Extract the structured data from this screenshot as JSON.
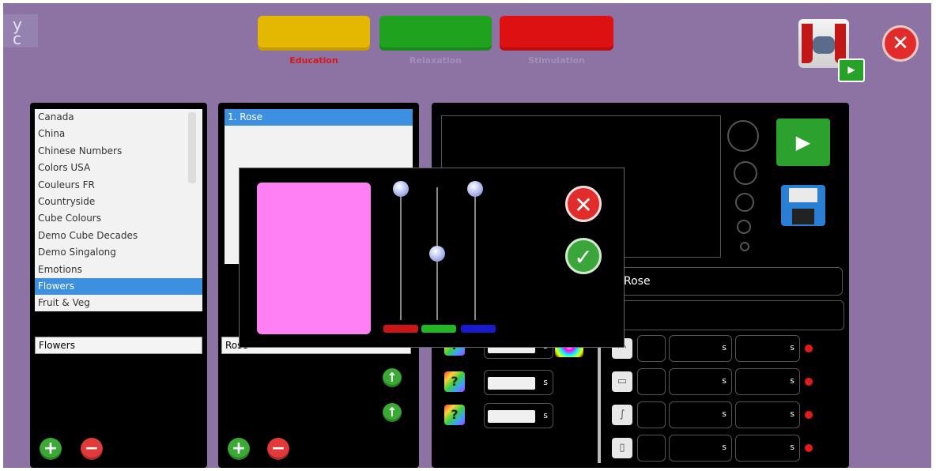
{
  "app": {
    "logo_text": "y\nc"
  },
  "tabs": [
    {
      "label": "Education",
      "color": "#e4b800",
      "label_color": "#d21a1a"
    },
    {
      "label": "Relaxation",
      "color": "#1fa31f",
      "label_color": "#a08fb8"
    },
    {
      "label": "Stimulation",
      "color": "#dd1111",
      "label_color": "#a08fb8"
    }
  ],
  "top_right": {
    "theater_icon": "theater-icon",
    "close_icon": "close-icon"
  },
  "left_panel": {
    "items": [
      "Canada",
      "China",
      "Chinese Numbers",
      "Colors USA",
      "Couleurs FR",
      "Countryside",
      "Cube Colours",
      "Demo Cube Decades",
      "Demo Singalong",
      "Emotions",
      "Flowers",
      "Fruit & Veg"
    ],
    "selected_index": 10,
    "name_value": "Flowers"
  },
  "middle_panel": {
    "items": [
      "1.  Rose"
    ],
    "name_value": "Rose"
  },
  "right_panel": {
    "name_value": "Rose",
    "second_value": "",
    "unit": "s"
  },
  "color_dialog": {
    "preview_color": "#ff7ff5",
    "red": 1.0,
    "green": 0.5,
    "blue": 1.0,
    "cancel_icon": "close-icon",
    "confirm_icon": "check-icon"
  },
  "buttons": {
    "add": "+",
    "remove": "−",
    "up": "↑"
  }
}
